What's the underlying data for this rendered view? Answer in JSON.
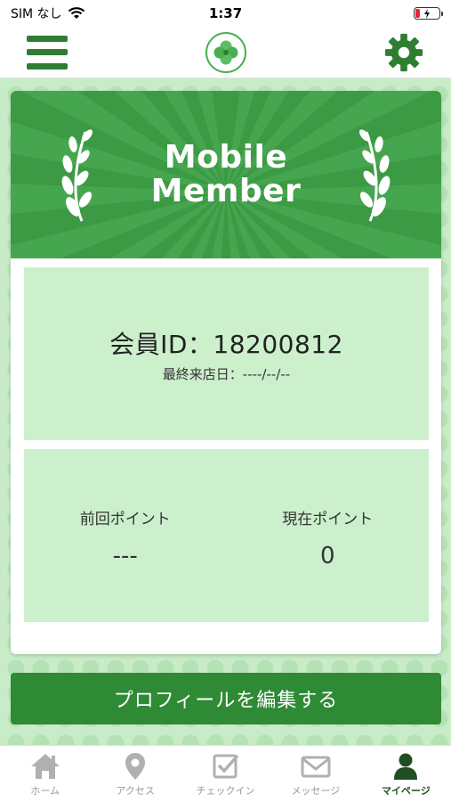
{
  "status_bar": {
    "carrier": "SIM なし",
    "time": "1:37"
  },
  "header": {
    "menu_icon": "hamburger-menu-icon",
    "logo_icon": "clover-logo",
    "settings_icon": "gear-icon"
  },
  "card": {
    "banner_line1": "Mobile",
    "banner_line2": "Member",
    "member_id_text": "会員ID：18200812",
    "last_visit_text": "最終来店日：----/--/--",
    "previous_points_label": "前回ポイント",
    "previous_points_value": "---",
    "current_points_label": "現在ポイント",
    "current_points_value": "0"
  },
  "edit_profile_label": "プロフィールを編集する",
  "bottom_nav": {
    "items": [
      {
        "label": "ホーム",
        "icon": "home-icon"
      },
      {
        "label": "アクセス",
        "icon": "map-pin-icon"
      },
      {
        "label": "チェックイン",
        "icon": "checkin-icon"
      },
      {
        "label": "メッセージ",
        "icon": "mail-icon"
      },
      {
        "label": "マイページ",
        "icon": "user-icon"
      }
    ],
    "active_index": 4
  },
  "colors": {
    "accent": "#2f8a35",
    "banner": "#43a04b",
    "panel": "#ccefcc",
    "nav_active": "#1e4e22",
    "nav_inactive": "#9a9a9a"
  }
}
